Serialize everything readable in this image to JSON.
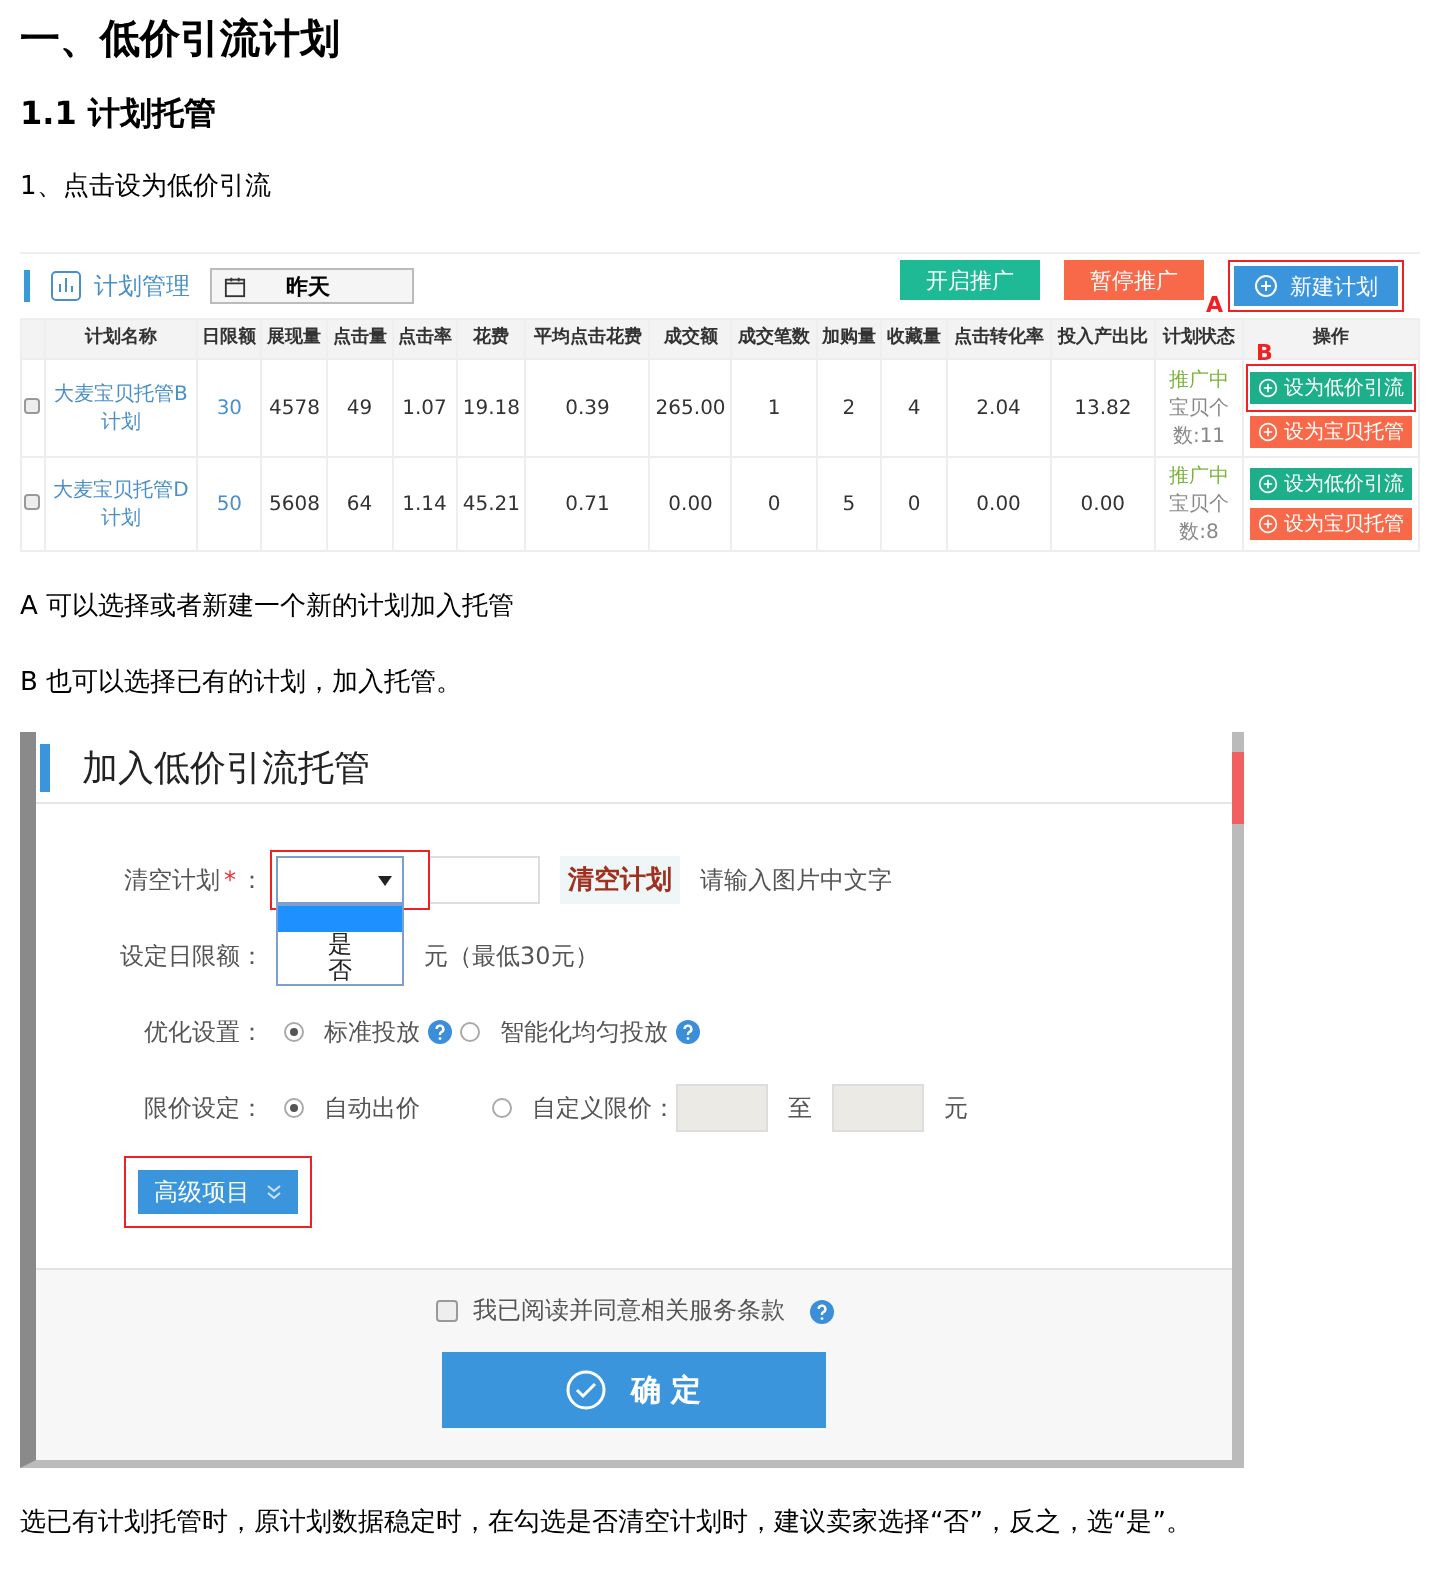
{
  "heading": "一、低价引流计划",
  "subheading": "1.1 计划托管",
  "step": "1、点击设为低价引流",
  "plan_panel": {
    "title": "计划管理",
    "date": "昨天",
    "buttons": [
      {
        "label": "开启推广",
        "kind": "start",
        "highlighted": false
      },
      {
        "label": "暂停推广",
        "kind": "pause",
        "highlighted": false
      },
      {
        "label": "新建计划",
        "kind": "new",
        "highlighted": true,
        "marker": "A"
      }
    ],
    "columns": [
      "",
      "计划名称",
      "日限额",
      "展现量",
      "点击量",
      "点击率",
      "花费",
      "平均点击花费",
      "成交额",
      "成交笔数",
      "加购量",
      "收藏量",
      "点击转化率",
      "投入产出比",
      "计划状态",
      "操作"
    ],
    "rows": [
      {
        "checked": false,
        "cells": [
          "",
          "大麦宝贝托管B计划",
          "30",
          "4578",
          "49",
          "1.07",
          "19.18",
          "0.39",
          "265.00",
          "1",
          "2",
          "4",
          "2.04",
          "13.82"
        ],
        "status": "推广中",
        "item_count": "宝贝个数:11",
        "actions": [
          {
            "label": "设为低价引流",
            "kind": "low_price",
            "highlighted": true,
            "marker": "B"
          },
          {
            "label": "设为宝贝托管",
            "kind": "managed",
            "highlighted": false
          }
        ]
      },
      {
        "checked": false,
        "cells": [
          "",
          "大麦宝贝托管D计划",
          "50",
          "5608",
          "64",
          "1.14",
          "45.21",
          "0.71",
          "0.00",
          "0",
          "5",
          "0",
          "0.00",
          "0.00"
        ],
        "status": "推广中",
        "item_count": "宝贝个数:8",
        "actions": [
          {
            "label": "设为低价引流",
            "kind": "low_price",
            "highlighted": false
          },
          {
            "label": "设为宝贝托管",
            "kind": "managed",
            "highlighted": false
          }
        ]
      }
    ]
  },
  "note_a": "A 可以选择或者新建一个新的计划加入托管",
  "note_b": "B 也可以选择已有的计划，加入托管。",
  "dialog": {
    "title": "加入低价引流托管",
    "clear_plan": {
      "label": "清空计划",
      "required_mark": "*",
      "suffix": "：",
      "open": true,
      "highlighted": true,
      "options": [
        {
          "label": "是",
          "selected": false
        },
        {
          "label": "否",
          "selected": false
        }
      ],
      "captcha": "清空计划",
      "captcha_hint": "请输入图片中文字"
    },
    "daily_limit": {
      "label": "设定日限额：",
      "hint": "元（最低30元）"
    },
    "optimization": {
      "label": "优化设置：",
      "options": [
        {
          "label": "标准投放",
          "selected": true,
          "help": true
        },
        {
          "label": "智能化均匀投放",
          "selected": false,
          "help": true
        }
      ]
    },
    "price_limit": {
      "label": "限价设定：",
      "options": [
        {
          "label": "自动出价",
          "selected": true
        },
        {
          "label": "自定义限价：",
          "selected": false
        }
      ],
      "to": "至",
      "unit": "元"
    },
    "advanced": {
      "label": "高级项目",
      "highlighted": true
    },
    "agreement": {
      "label": "我已阅读并同意相关服务条款",
      "checked": false
    },
    "confirm": "确 定"
  },
  "conclusion": "选已有计划托管时，原计划数据稳定时，在勾选是否清空计划时，建议卖家选择“否”，反之，选“是”。"
}
